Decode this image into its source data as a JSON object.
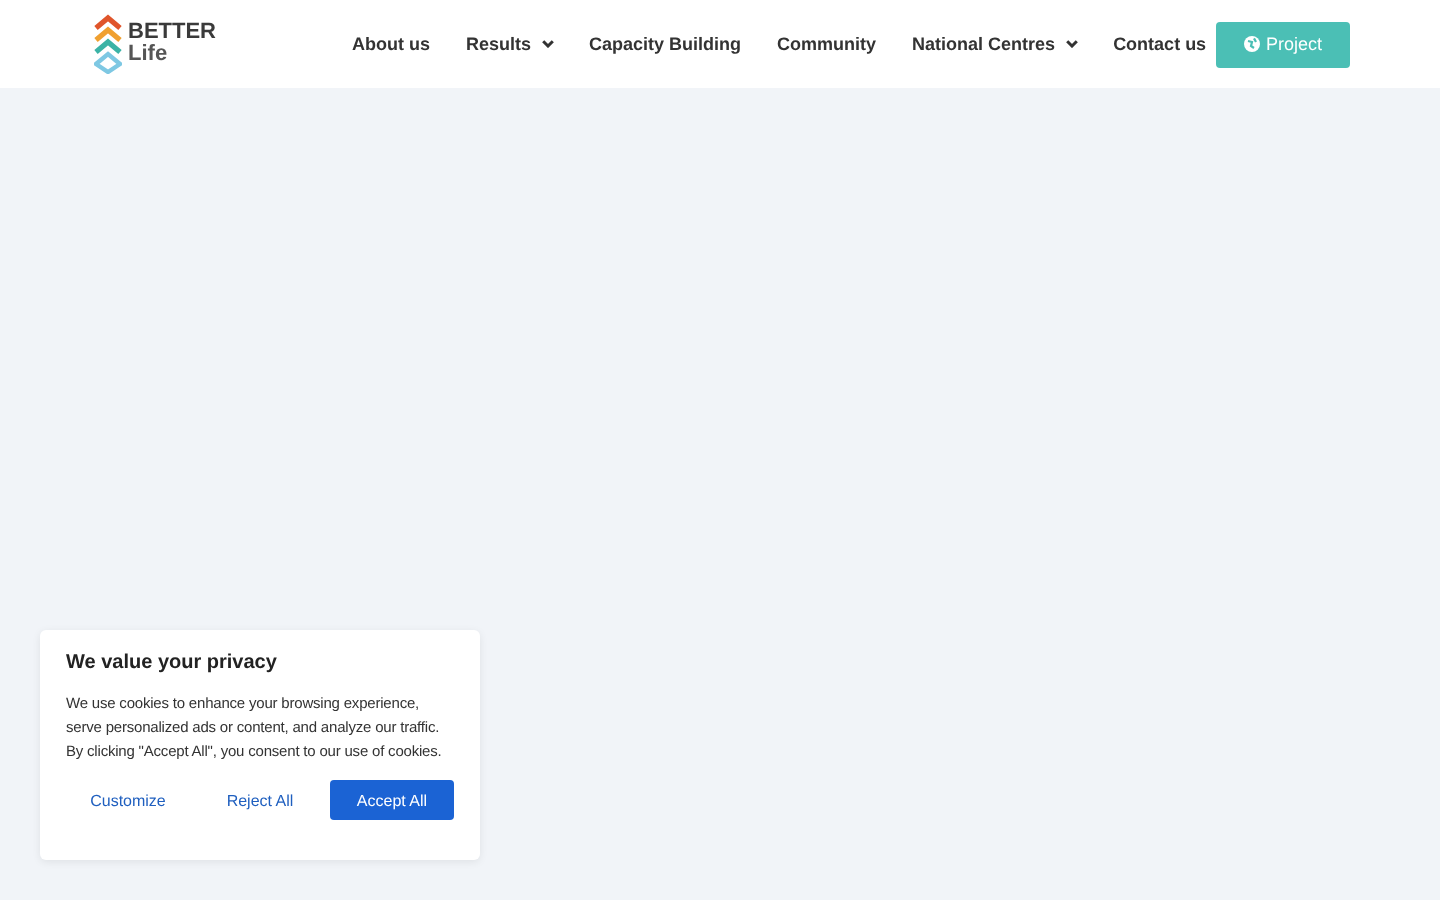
{
  "logo": {
    "line1": "BETTER",
    "line2": "Life"
  },
  "nav": [
    {
      "label": "About us",
      "dropdown": false
    },
    {
      "label": "Results",
      "dropdown": true
    },
    {
      "label": "Capacity Building",
      "dropdown": false
    },
    {
      "label": "Community",
      "dropdown": false
    },
    {
      "label": "National Centres",
      "dropdown": true
    },
    {
      "label": "Contact us",
      "dropdown": false
    }
  ],
  "cta": {
    "label": "Project"
  },
  "cookie_banner": {
    "title": "We value your privacy",
    "text": "We use cookies to enhance your browsing experience, serve personalized ads or content, and analyze our traffic. By clicking \"Accept All\", you consent to our use of cookies.",
    "buttons": [
      {
        "label": "Customize",
        "kind": "link"
      },
      {
        "label": "Reject All",
        "kind": "link"
      },
      {
        "label": "Accept All",
        "kind": "primary"
      }
    ]
  }
}
